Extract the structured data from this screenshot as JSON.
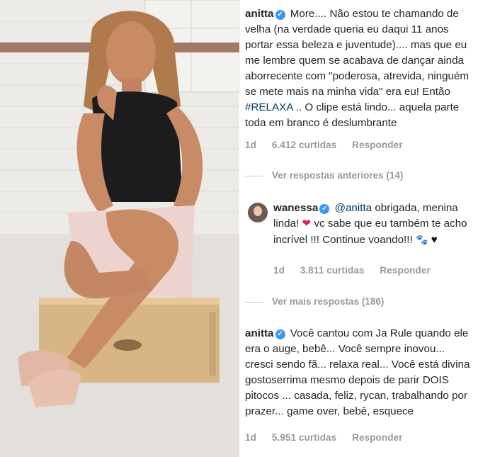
{
  "comments": [
    {
      "user": "anitta",
      "verified": true,
      "text_before_hashtag": "More.... Não estou te chamando de velha (na verdade queria eu daqui 11 anos portar essa beleza e juventude).... mas que eu me lembre quem se acabava de dançar ainda aborrecente com \"poderosa, atrevida, ninguém se mete mais na minha vida\"  era eu! Então ",
      "hashtag": "#RELAXA",
      "text_after_hashtag": " .. O clipe está lindo... aquela parte toda em branco é deslumbrante",
      "time": "1d",
      "likes": "6.412 curtidas",
      "reply_label": "Responder"
    },
    {
      "user": "wanessa",
      "verified": true,
      "mention": "@anitta",
      "text_before_heart": " obrigada, menina linda! ",
      "text_after_heart": " vc sabe que eu também te acho incrível !!! Continue voando!!! ",
      "time": "1d",
      "likes": "3.811 curtidas",
      "reply_label": "Responder"
    },
    {
      "user": "anitta",
      "verified": true,
      "text": "Você cantou com Ja Rule quando ele era o auge, bebê... Você sempre inovou... cresci sendo fã... relaxa real... Você está divina gostoserrima mesmo depois de parir DOIS pitocos ... casada, feliz, rycan, trabalhando por prazer... game over, bebê, esquece",
      "time": "1d",
      "likes": "5.951 curtidas",
      "reply_label": "Responder"
    }
  ],
  "view_previous_replies": "Ver respostas anteriores (14)",
  "view_more_replies": "Ver mais respostas (186)",
  "icons": {
    "verified": "verified-badge-icon",
    "heart": "red-heart-emoji",
    "paws": "paw-prints-emoji",
    "black_heart": "black-heart-emoji"
  },
  "colors": {
    "text": "#262626",
    "meta": "#999999",
    "verified": "#3897f0",
    "hashtag": "#003569"
  }
}
